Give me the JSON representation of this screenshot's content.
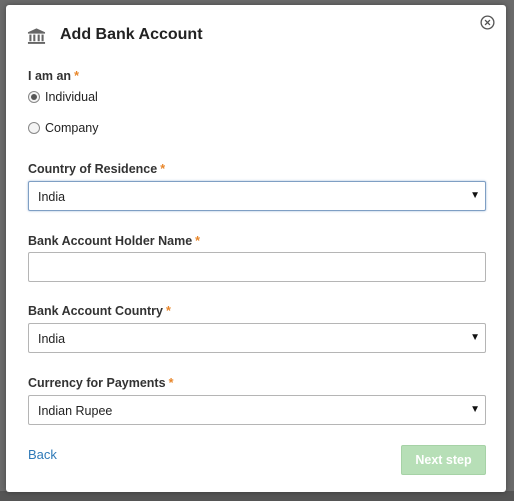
{
  "dialog": {
    "title": "Add Bank Account",
    "icon": "bank-icon",
    "close_icon": "close-icon"
  },
  "entity_type": {
    "label": "I am an",
    "required_mark": "*",
    "options": [
      {
        "label": "Individual",
        "checked": true
      },
      {
        "label": "Company",
        "checked": false
      }
    ]
  },
  "residence_country": {
    "label": "Country of Residence",
    "required_mark": "*",
    "value": "India"
  },
  "holder_name": {
    "label": "Bank Account Holder Name",
    "required_mark": "*",
    "value": ""
  },
  "bank_country": {
    "label": "Bank Account Country",
    "required_mark": "*",
    "value": "India"
  },
  "currency": {
    "label": "Currency for Payments",
    "required_mark": "*",
    "value": "Indian Rupee"
  },
  "actions": {
    "back_label": "Back",
    "next_label": "Next step"
  },
  "colors": {
    "required": "#e8862a",
    "link": "#2f7ab8",
    "next_disabled_bg": "#b7dfb7"
  }
}
